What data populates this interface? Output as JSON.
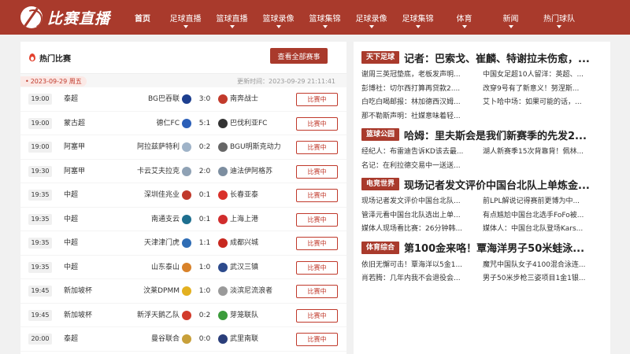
{
  "header": {
    "logo_text": "比赛直播",
    "nav": [
      {
        "label": "首页",
        "active": true,
        "caret": false
      },
      {
        "label": "足球直播",
        "caret": true
      },
      {
        "label": "篮球直播",
        "caret": true
      },
      {
        "label": "篮球录像",
        "caret": true
      },
      {
        "label": "篮球集锦",
        "caret": true
      },
      {
        "label": "足球录像",
        "caret": true
      },
      {
        "label": "足球集锦",
        "caret": true
      },
      {
        "label": "体育",
        "caret": true
      },
      {
        "label": "新闻",
        "caret": true
      },
      {
        "label": "热门球队",
        "caret": true
      }
    ]
  },
  "hot_matches": {
    "title": "热门比赛",
    "view_all_label": "查看全部赛事",
    "date": "2023-09-29 周五",
    "update_time": "更新时间：2023-09-29 21:11:41",
    "matches": [
      {
        "time": "19:00",
        "league": "泰超",
        "home": "BG巴吞联",
        "score": "3:0",
        "away": "南奔战士",
        "status": "比赛中",
        "home_color": "#1d3f8f",
        "away_color": "#c23a2b"
      },
      {
        "time": "19:00",
        "league": "蒙古超",
        "home": "德仁FC",
        "score": "5:1",
        "away": "巴伐利亚FC",
        "status": "比赛中",
        "home_color": "#2b5fb8",
        "away_color": "#333333"
      },
      {
        "time": "19:00",
        "league": "阿塞甲",
        "home": "阿拉兹萨特利",
        "score": "0:2",
        "away": "BGU明斯克动力",
        "status": "比赛中",
        "home_color": "#9fb3c8",
        "away_color": "#666666"
      },
      {
        "time": "19:30",
        "league": "阿塞甲",
        "home": "卡云艾夫拉克",
        "score": "2:0",
        "away": "迪法伊阿格苏",
        "status": "比赛中",
        "home_color": "#8fa2b5",
        "away_color": "#7d8ea0"
      },
      {
        "time": "19:35",
        "league": "中超",
        "home": "深圳佳兆业",
        "score": "0:1",
        "away": "长春亚泰",
        "status": "比赛中",
        "home_color": "#c0392b",
        "away_color": "#d9302a"
      },
      {
        "time": "19:35",
        "league": "中超",
        "home": "南通支云",
        "score": "0:1",
        "away": "上海上港",
        "status": "比赛中",
        "home_color": "#1e6f8f",
        "away_color": "#d12d2d"
      },
      {
        "time": "19:35",
        "league": "中超",
        "home": "天津津门虎",
        "score": "1:1",
        "away": "成都兴城",
        "status": "比赛中",
        "home_color": "#2f6db5",
        "away_color": "#c8281f"
      },
      {
        "time": "19:35",
        "league": "中超",
        "home": "山东泰山",
        "score": "1:0",
        "away": "武汉三镇",
        "status": "比赛中",
        "home_color": "#d8822a",
        "away_color": "#2c4a8c"
      },
      {
        "time": "19:45",
        "league": "新加坡杯",
        "home": "汶莱DPMM",
        "score": "1:0",
        "away": "淡滨尼流浪者",
        "status": "比赛中",
        "home_color": "#e3b020",
        "away_color": "#9a9a9a"
      },
      {
        "time": "19:45",
        "league": "新加坡杯",
        "home": "新浮天鹅乙队",
        "score": "0:2",
        "away": "芽笼联队",
        "status": "比赛中",
        "home_color": "#d23a2a",
        "away_color": "#3b9b3b"
      },
      {
        "time": "20:00",
        "league": "泰超",
        "home": "曼谷联合",
        "score": "0:0",
        "away": "武里南联",
        "status": "比赛中",
        "home_color": "#c8a03a",
        "away_color": "#2a3e7a"
      }
    ]
  },
  "news": [
    {
      "category": "天下足球",
      "headline": "记者：巴索戈、崔麟、特谢拉未伤愈，...",
      "items": [
        "谢周三英冠垫底，老板发声明...",
        "中国女足超10人留洋：英超、...",
        "彭博社：切尔西打算再贷款2....",
        "改穿9号有了新意义！努涅斯...",
        "白吃白喝邮报：林加德西汉姆...",
        "艾卜哈中场：如果可能的话，...",
        "那不勒斯声明：社媒意味着轻..."
      ]
    },
    {
      "category": "篮球公园",
      "headline": "哈姆：里夫斯会是我们新赛季的先发2...",
      "items": [
        "经纪人：布雷迪告诉KD该去最...",
        "湖人新赛季15次背靠背！佩林...",
        "名记：在利拉德交易中一送送..."
      ]
    },
    {
      "category": "电竞世界",
      "headline": "现场记者发文评价中国台北队上单炼金...",
      "items": [
        "现场记者发文评价中国台北队...",
        "前LPL解说记得赛前更博为中...",
        "管泽元看中国台北队选出上单...",
        "有点尴尬中国台北选手FoFo被...",
        "媒体人现场看比赛：26分钟韩...",
        "媒体人：中国台北队登场Kars..."
      ]
    },
    {
      "category": "体育综合",
      "headline": "第100金来咯！覃海洋男子50米蛙泳...",
      "items": [
        "依旧无懈可击！覃海洋以5金1...",
        "魔咒中国队女子4100混合泳连...",
        "肖若腾：几年内我不会退役会...",
        "男子50米步枪三姿项目1金1银..."
      ]
    }
  ]
}
